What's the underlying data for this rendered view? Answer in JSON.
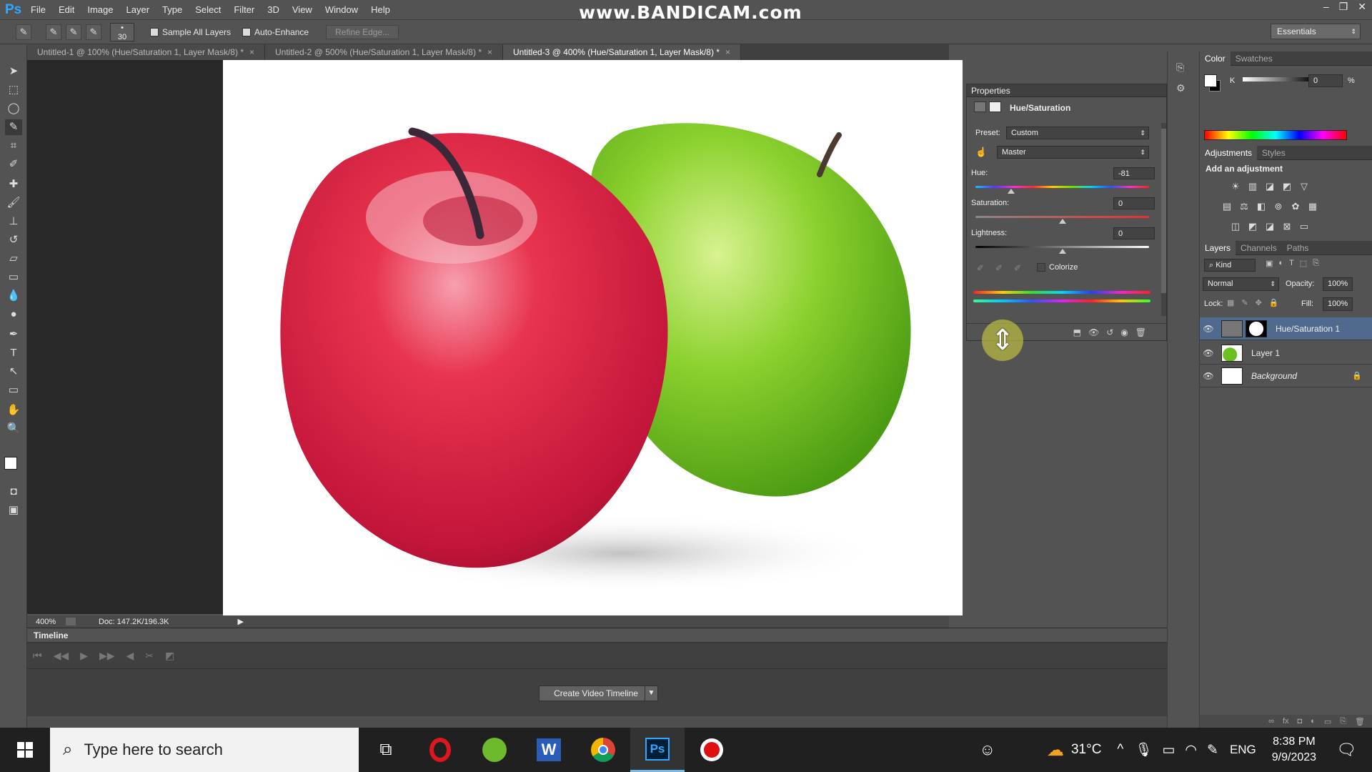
{
  "app": {
    "logo": "Ps",
    "watermark": "www.BANDICAM.com",
    "window_controls": [
      "–",
      "❐",
      "✕"
    ]
  },
  "menu": [
    "File",
    "Edit",
    "Image",
    "Layer",
    "Type",
    "Select",
    "Filter",
    "3D",
    "View",
    "Window",
    "Help"
  ],
  "options": {
    "brush_size": "30",
    "sample_all_layers": "Sample All Layers",
    "auto_enhance": "Auto-Enhance",
    "refine_edge": "Refine Edge...",
    "workspace": "Essentials"
  },
  "tabs": [
    {
      "label": "Untitled-1 @ 100% (Hue/Saturation 1, Layer Mask/8) *",
      "close": "×"
    },
    {
      "label": "Untitled-2 @ 500% (Hue/Saturation 1, Layer Mask/8) *",
      "close": "×"
    },
    {
      "label": "Untitled-3 @ 400% (Hue/Saturation 1, Layer Mask/8) *",
      "close": "×"
    }
  ],
  "status": {
    "zoom": "400%",
    "doc": "Doc: 147.2K/196.3K"
  },
  "timeline": {
    "title": "Timeline",
    "create_button": "Create Video Timeline"
  },
  "properties": {
    "title": "Properties",
    "adjustment": "Hue/Saturation",
    "preset_label": "Preset:",
    "preset_value": "Custom",
    "channel": "Master",
    "hue_label": "Hue:",
    "hue_value": "-81",
    "saturation_label": "Saturation:",
    "saturation_value": "0",
    "lightness_label": "Lightness:",
    "lightness_value": "0",
    "colorize": "Colorize"
  },
  "color_panel": {
    "tabs": [
      "Color",
      "Swatches"
    ],
    "channel": "K",
    "value": "0",
    "unit": "%"
  },
  "adjustments_panel": {
    "tabs": [
      "Adjustments",
      "Styles"
    ],
    "heading": "Add an adjustment"
  },
  "layers_panel": {
    "tabs": [
      "Layers",
      "Channels",
      "Paths"
    ],
    "filter": "Kind",
    "blend_mode": "Normal",
    "opacity_label": "Opacity:",
    "opacity_value": "100%",
    "lock_label": "Lock:",
    "fill_label": "Fill:",
    "fill_value": "100%",
    "layers": [
      {
        "name": "Hue/Saturation 1",
        "selected": true
      },
      {
        "name": "Layer 1",
        "selected": false
      },
      {
        "name": "Background",
        "selected": false
      }
    ]
  },
  "taskbar": {
    "search_placeholder": "Type here to search",
    "temperature": "31°C",
    "language": "ENG",
    "time": "8:38 PM",
    "date": "9/9/2023"
  }
}
